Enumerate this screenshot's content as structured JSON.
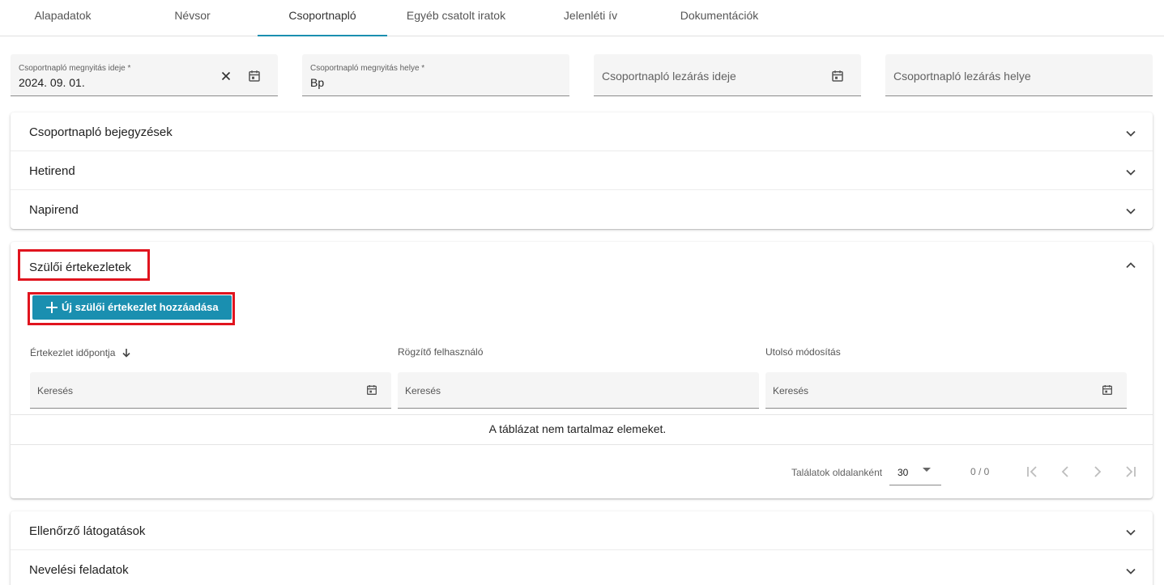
{
  "tabs": [
    {
      "label": "Alapadatok"
    },
    {
      "label": "Névsor"
    },
    {
      "label": "Csoportnapló"
    },
    {
      "label": "Egyéb csatolt iratok"
    },
    {
      "label": "Jelenléti ív"
    },
    {
      "label": "Dokumentációk"
    }
  ],
  "top_fields": {
    "open_date": {
      "label": "Csoportnapló megnyitás ideje *",
      "value": "2024. 09. 01."
    },
    "open_place": {
      "label": "Csoportnapló megnyitás helye *",
      "value": "Bp"
    },
    "close_date": {
      "placeholder": "Csoportnapló lezárás ideje"
    },
    "close_place": {
      "placeholder": "Csoportnapló lezárás helye"
    }
  },
  "sections_top": [
    {
      "label": "Csoportnapló bejegyzések"
    },
    {
      "label": "Hetirend"
    },
    {
      "label": "Napirend"
    }
  ],
  "parent_meetings": {
    "title": "Szülői értekezletek",
    "add_button": "Új szülői értekezlet hozzáadása",
    "columns": [
      {
        "label": "Értekezlet időpontja"
      },
      {
        "label": "Rögzítő felhasználó"
      },
      {
        "label": "Utolsó módosítás"
      }
    ],
    "search_placeholder": "Keresés",
    "empty_message": "A táblázat nem tartalmaz elemeket.",
    "paginator": {
      "page_size_label": "Találatok oldalanként",
      "page_size": "30",
      "range": "0 / 0"
    }
  },
  "sections_bottom": [
    {
      "label": "Ellenőrző látogatások"
    },
    {
      "label": "Nevelési feladatok"
    }
  ],
  "colors": {
    "accent": "#1a8fb0",
    "highlight": "#e0141e"
  }
}
